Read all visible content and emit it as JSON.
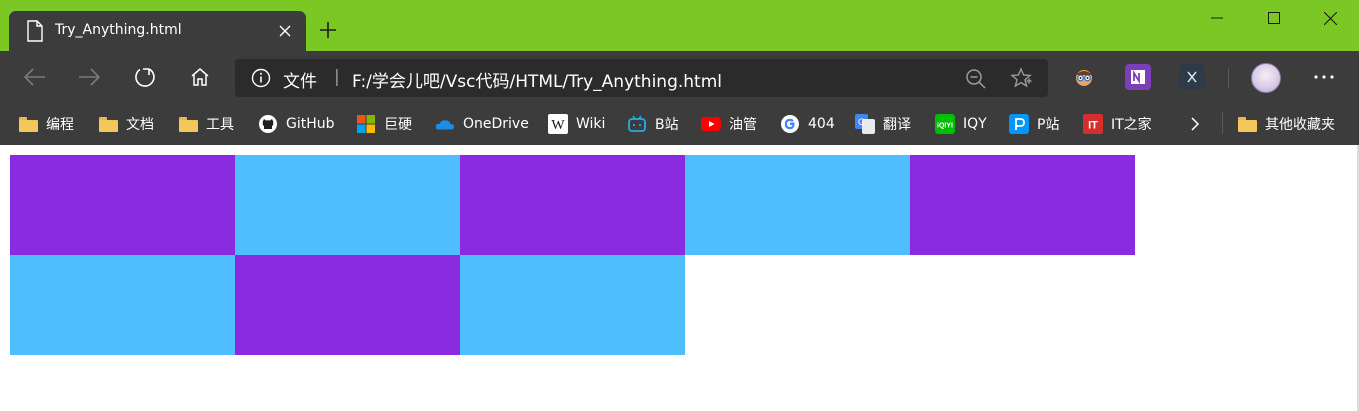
{
  "tab": {
    "title": "Try_Anything.html"
  },
  "address_bar": {
    "site_label": "文件",
    "separator": "|",
    "url": "F:/学会儿吧/Vsc代码/HTML/Try_Anything.html"
  },
  "bookmarks": [
    {
      "label": "编程",
      "icon": "folder-icon"
    },
    {
      "label": "文档",
      "icon": "folder-icon"
    },
    {
      "label": "工具",
      "icon": "folder-icon"
    },
    {
      "label": "GitHub",
      "icon": "github-icon"
    },
    {
      "label": "巨硬",
      "icon": "microsoft-icon"
    },
    {
      "label": "OneDrive",
      "icon": "onedrive-icon"
    },
    {
      "label": "Wiki",
      "icon": "wikipedia-icon"
    },
    {
      "label": "B站",
      "icon": "bilibili-icon"
    },
    {
      "label": "油管",
      "icon": "youtube-icon"
    },
    {
      "label": "404",
      "icon": "google-icon"
    },
    {
      "label": "翻译",
      "icon": "translate-icon"
    },
    {
      "label": "IQY",
      "icon": "iqiyi-icon"
    },
    {
      "label": "P站",
      "icon": "pixiv-icon"
    },
    {
      "label": "IT之家",
      "icon": "ithome-icon"
    }
  ],
  "other_bookmarks": {
    "label": "其他收藏夹"
  },
  "colors": {
    "title_bar": "#7bc825",
    "chrome": "#3c3c3c",
    "purple": "#8a2be2",
    "blue": "#4fbeff"
  },
  "page": {
    "blocks": [
      "purple",
      "blue",
      "purple",
      "blue",
      "purple",
      "blue",
      "purple",
      "blue"
    ]
  }
}
